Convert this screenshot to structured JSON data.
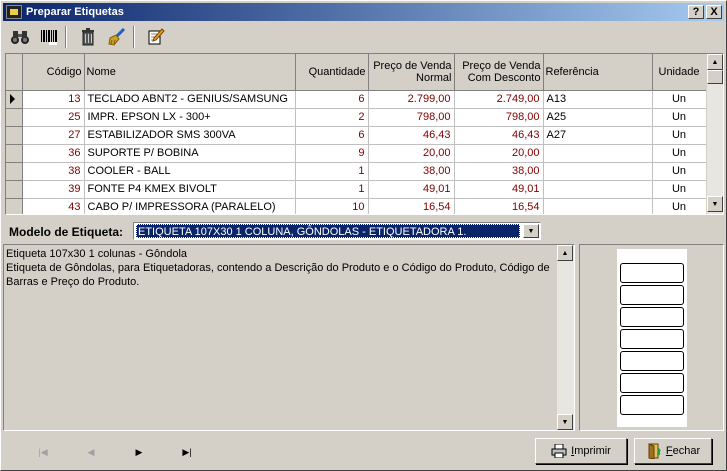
{
  "window": {
    "title": "Preparar Etiquetas",
    "help_label": "?",
    "close_label": "X"
  },
  "toolbar": {
    "icons": [
      "binoculars-icon",
      "barcode-icon",
      "trash-icon",
      "broom-icon",
      "edit-icon"
    ]
  },
  "grid": {
    "headers": {
      "codigo": "Código",
      "nome": "Nome",
      "quantidade": "Quantidade",
      "preco_normal_1": "Preço de Venda",
      "preco_normal_2": "Normal",
      "preco_desc_1": "Preço de Venda",
      "preco_desc_2": "Com Desconto",
      "referencia": "Referência",
      "unidade": "Unidade"
    },
    "rows": [
      {
        "codigo": "13",
        "nome": "TECLADO ABNT2 - GENIUS/SAMSUNG",
        "quantidade": "6",
        "preco_normal": "2.799,00",
        "preco_desc": "2.749,00",
        "referencia": "A13",
        "unidade": "Un"
      },
      {
        "codigo": "25",
        "nome": "IMPR. EPSON LX - 300+",
        "quantidade": "2",
        "preco_normal": "798,00",
        "preco_desc": "798,00",
        "referencia": "A25",
        "unidade": "Un"
      },
      {
        "codigo": "27",
        "nome": "ESTABILIZADOR SMS 300VA",
        "quantidade": "6",
        "preco_normal": "46,43",
        "preco_desc": "46,43",
        "referencia": "A27",
        "unidade": "Un"
      },
      {
        "codigo": "36",
        "nome": "SUPORTE P/ BOBINA",
        "quantidade": "9",
        "preco_normal": "20,00",
        "preco_desc": "20,00",
        "referencia": "",
        "unidade": "Un"
      },
      {
        "codigo": "38",
        "nome": "COOLER - BALL",
        "quantidade": "1",
        "preco_normal": "38,00",
        "preco_desc": "38,00",
        "referencia": "",
        "unidade": "Un"
      },
      {
        "codigo": "39",
        "nome": "FONTE P4 KMEX BIVOLT",
        "quantidade": "1",
        "preco_normal": "49,01",
        "preco_desc": "49,01",
        "referencia": "",
        "unidade": "Un"
      },
      {
        "codigo": "43",
        "nome": "CABO P/ IMPRESSORA (PARALELO)",
        "quantidade": "10",
        "preco_normal": "16,54",
        "preco_desc": "16,54",
        "referencia": "",
        "unidade": "Un"
      }
    ]
  },
  "modelo": {
    "label": "Modelo de Etiqueta:",
    "selected": "ETIQUETA 107X30 1 COLUNA, GÔNDOLAS - ETIQUETADORA 1."
  },
  "description": {
    "line1": "Etiqueta 107x30 1 colunas - Gôndola",
    "line2": "Etiqueta de Gôndolas, para Etiquetadoras, contendo a Descrição do Produto e o Código do Produto, Código de Barras e Preço do Produto."
  },
  "buttons": {
    "imprimir": {
      "underline": "I",
      "rest": "mprimir"
    },
    "fechar": {
      "underline": "F",
      "rest": "echar"
    }
  },
  "colors": {
    "title_start": "#0a246a",
    "title_end": "#a6caf0",
    "value_red": "#800000",
    "selection": "#0a246a"
  }
}
